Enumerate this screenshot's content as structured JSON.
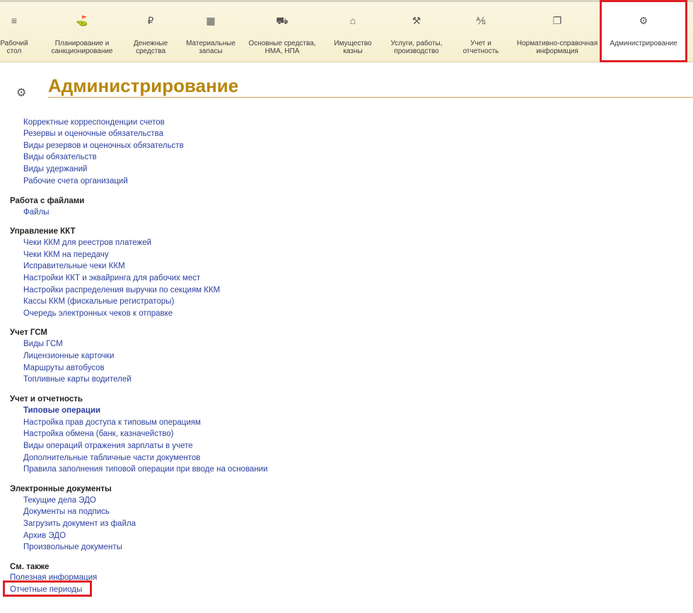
{
  "sections": [
    {
      "label": "Рабочий стол",
      "icon": "menu-icon",
      "glyph": "≡"
    },
    {
      "label": "Планирование и санкционирование",
      "icon": "planning-icon",
      "glyph": "⛳"
    },
    {
      "label": "Денежные средства",
      "icon": "ruble-icon",
      "glyph": "₽"
    },
    {
      "label": "Материальные запасы",
      "icon": "grid-icon",
      "glyph": "▦"
    },
    {
      "label": "Основные средства, НМА, НПА",
      "icon": "truck-icon",
      "glyph": "⛟"
    },
    {
      "label": "Имущество казны",
      "icon": "building-icon",
      "glyph": "⌂"
    },
    {
      "label": "Услуги, работы, производство",
      "icon": "tools-icon",
      "glyph": "⚒"
    },
    {
      "label": "Учет и отчетность",
      "icon": "accounting-icon",
      "glyph": "⅍"
    },
    {
      "label": "Нормативно-справочная информация",
      "icon": "documents-icon",
      "glyph": "❐"
    },
    {
      "label": "Администрирование",
      "icon": "gear-icon",
      "glyph": "⚙"
    }
  ],
  "page": {
    "title": "Администрирование",
    "gear": "⚙"
  },
  "top_links": [
    "Корректные корреспонденции счетов",
    "Резервы и оценочные обязательства",
    "Виды резервов и оценочных обязательств",
    "Виды обязательств",
    "Виды удержаний",
    "Рабочие счета организаций"
  ],
  "groups": [
    {
      "title": "Работа с файлами",
      "items": [
        "Файлы"
      ]
    },
    {
      "title": "Управление ККТ",
      "items": [
        "Чеки ККМ для реестров платежей",
        "Чеки ККМ на передачу",
        "Исправительные чеки ККМ",
        "Настройки ККТ и эквайринга для рабочих мест",
        "Настройки распределения выручки по секциям ККМ",
        "Кассы ККМ (фискальные регистраторы)",
        "Очередь электронных чеков к отправке"
      ]
    },
    {
      "title": "Учет ГСМ",
      "items": [
        "Виды ГСМ",
        "Лицензионные карточки",
        "Маршруты автобусов",
        "Топливные карты водителей"
      ]
    },
    {
      "title": "Учет и отчетность",
      "items": [
        "Типовые операции",
        "Настройка прав доступа к типовым операциям",
        "Настройка обмена (банк, казначейство)",
        "Виды операций отражения зарплаты в учете",
        "Дополнительные табличные части документов",
        "Правила заполнения типовой операции при вводе на основании"
      ]
    },
    {
      "title": "Электронные документы",
      "items": [
        "Текущие дела ЭДО",
        "Документы на подпись",
        "Загрузить документ из файла",
        "Архив ЭДО",
        "Произвольные документы"
      ]
    }
  ],
  "see_also": {
    "title": "См. также",
    "items": [
      "Полезная информация",
      "Отчетные периоды"
    ]
  }
}
